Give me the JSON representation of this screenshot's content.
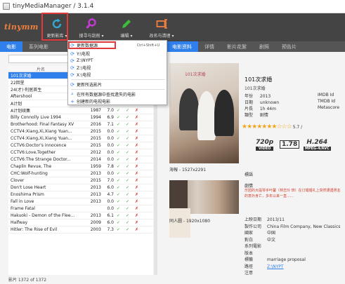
{
  "window": {
    "title": "tinyMediaManager / 3.1.4"
  },
  "toolbar": {
    "logo": "tinymm",
    "buttons": [
      {
        "label": "更新影库 ▾",
        "icon": "refresh-icon",
        "color": "#31a8d6"
      },
      {
        "label": "搜寻与刮削 ▾",
        "icon": "magnifier-icon",
        "color": "#c43bd6"
      },
      {
        "label": "编辑 ▾",
        "icon": "pencil-icon",
        "color": "#3bbd3b"
      },
      {
        "label": "改名与清理 ▾",
        "icon": "rename-icon",
        "color": "#f07f3e"
      }
    ]
  },
  "left_tabs": [
    "电影",
    "系列电影"
  ],
  "right_tabs": [
    "电影资料",
    "详情",
    "影片花絮",
    "剧照",
    "预告片"
  ],
  "update_menu": {
    "items": [
      {
        "label": "更新数据源",
        "shortcut": "Ctrl+Shift+U",
        "icon": "refresh-icon"
      },
      {
        "label": "Y:\\电视",
        "icon": "refresh-icon"
      },
      {
        "label": "Z:\\NYPT",
        "icon": "refresh-icon"
      },
      {
        "label": "Z:\\电视",
        "icon": "refresh-icon"
      },
      {
        "label": "X:\\电视",
        "icon": "refresh-icon"
      },
      {
        "label": "更新所选影片",
        "icon": "refresh-icon"
      },
      {
        "label": "在所有数据源中查找遗失的电影",
        "icon": "magnifier-icon"
      },
      {
        "label": "创建新的电视电影",
        "icon": "plus-icon"
      }
    ]
  },
  "movie_list": {
    "header": "片名",
    "rows": [
      {
        "title": "101次求婚",
        "year": "",
        "rating": "",
        "c1": "",
        "c2": "",
        "c3": "",
        "selected": true
      },
      {
        "title": "22回里",
        "year": "",
        "rating": "",
        "c1": "",
        "c2": "",
        "c3": ""
      },
      {
        "title": "24(才)·利居首生",
        "year": "",
        "rating": "",
        "c1": "",
        "c2": "",
        "c3": ""
      },
      {
        "title": "Aftershool",
        "year": "2008",
        "rating": "5.6",
        "c1": "✓",
        "c2": "✓",
        "c3": "✗"
      },
      {
        "title": "A计划",
        "year": "1983",
        "rating": "7.2",
        "c1": "✓",
        "c2": "✓",
        "c3": "✗"
      },
      {
        "title": "A计划续集",
        "year": "1987",
        "rating": "7.0",
        "c1": "✓",
        "c2": "✓",
        "c3": "✗"
      },
      {
        "title": "Billy Connolly Live 1994",
        "year": "1994",
        "rating": "6.9",
        "c1": "✓",
        "c2": "✓",
        "c3": "✗"
      },
      {
        "title": "Brotherhood: Final Fantasy XV",
        "year": "2016",
        "rating": "7.1",
        "c1": "✓",
        "c2": "✓",
        "c3": "✗"
      },
      {
        "title": "CCTV4:Xiang,Xi,Xiang Yuan...",
        "year": "2015",
        "rating": "0.0",
        "c1": "✓",
        "c2": "✓",
        "c3": "✗"
      },
      {
        "title": "CCTV4:Xiang,Xi,Xiang Yuan...",
        "year": "2015",
        "rating": "0.0",
        "c1": "✓",
        "c2": "✓",
        "c3": "✗"
      },
      {
        "title": "CCTV6:Doctor's innocence",
        "year": "2015",
        "rating": "0.0",
        "c1": "✓",
        "c2": "✓",
        "c3": "✗"
      },
      {
        "title": "CCTV6:Love,Together",
        "year": "2012",
        "rating": "0.0",
        "c1": "✓",
        "c2": "✓",
        "c3": "✗"
      },
      {
        "title": "CCTV6:The Strange Doctor...",
        "year": "2014",
        "rating": "0.0",
        "c1": "✓",
        "c2": "✓",
        "c3": "✗"
      },
      {
        "title": "Chaplin Revue, The",
        "year": "1959",
        "rating": "7.8",
        "c1": "✓",
        "c2": "✓",
        "c3": "✗"
      },
      {
        "title": "CHC:Wolf-hunting",
        "year": "2013",
        "rating": "0.0",
        "c1": "✓",
        "c2": "✓",
        "c3": "✗"
      },
      {
        "title": "Clover",
        "year": "2015",
        "rating": "7.0",
        "c1": "✓",
        "c2": "✓",
        "c3": "✗"
      },
      {
        "title": "Don't Lose Heart",
        "year": "2013",
        "rating": "6.0",
        "c1": "✓",
        "c2": "✓",
        "c3": "✗"
      },
      {
        "title": "Enoshima Prism",
        "year": "2013",
        "rating": "4.7",
        "c1": "✓",
        "c2": "✓",
        "c3": "✗"
      },
      {
        "title": "Fall in Love",
        "year": "2013",
        "rating": "0.0",
        "c1": "✓",
        "c2": "✓",
        "c3": "✗"
      },
      {
        "title": "Frame Fatal",
        "year": "",
        "rating": "0.0",
        "c1": "✓",
        "c2": "✓",
        "c3": "✗"
      },
      {
        "title": "Hakuoki - Demon of the Flee...",
        "year": "2013",
        "rating": "6.1",
        "c1": "✓",
        "c2": "✓",
        "c3": "✗"
      },
      {
        "title": "Halfway",
        "year": "2009",
        "rating": "6.0",
        "c1": "✓",
        "c2": "✓",
        "c3": "✗"
      },
      {
        "title": "Hitler: The Rise of Evil",
        "year": "2003",
        "rating": "7.3",
        "c1": "✓",
        "c2": "✓",
        "c3": "✗"
      }
    ],
    "count_label": "影片  1372  of  1372"
  },
  "details": {
    "title": "101次求婚",
    "subtitle": "101次求婚",
    "year_label": "年份",
    "year": "2013",
    "date_label": "日期",
    "date": "unknown",
    "runtime_label": "片長",
    "runtime": "1h 44m",
    "genre_label": "類型",
    "genre": "剧情",
    "imdb_label": "IMDB Id",
    "tmdb_label": "TMDB Id",
    "meta_label": "Metascore",
    "stars": "★★★★★★★☆☆☆",
    "rating": "5.7 /",
    "badges": {
      "res": "720p",
      "res_sub": "VIDEO",
      "aspect": "1.78",
      "codec": "H.264",
      "codec_sub": "MPEG-4/AVC"
    },
    "poster_caption": "海報 - 1527x2291",
    "poster_title": "101次求婚",
    "fanart_caption": "同人圖 - 1920x1080",
    "tagline_label": "標語",
    "plot_label": "劇情",
    "plot": "乐团的大提琴手叶馨（林志玲 饰）在订婚婚礼上突然遭遇男友的意外身亡，多年以来一直……",
    "list": [
      {
        "k": "上映日期",
        "v": "2013/11"
      },
      {
        "k": "製作公司",
        "v": "China Film Company, New Classics"
      },
      {
        "k": "國家",
        "v": "中国"
      },
      {
        "k": "對白",
        "v": "中文"
      },
      {
        "k": "系列電影",
        "v": ""
      },
      {
        "k": "版本",
        "v": ""
      },
      {
        "k": "標籤",
        "v": "marriage proposal"
      },
      {
        "k": "路徑",
        "v": "Z:\\NYPT",
        "link": true
      },
      {
        "k": "注意",
        "v": ""
      }
    ]
  }
}
